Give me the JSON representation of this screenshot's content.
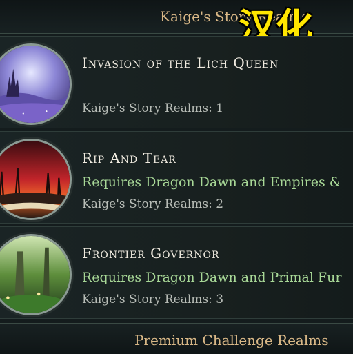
{
  "header": {
    "title": "Kaige's Story Realms"
  },
  "watermark": {
    "text": "汉化"
  },
  "realms": [
    {
      "title": "Invasion of the Lich Queen",
      "requirement": "",
      "subtitle": "Kaige's Story Realms: 1",
      "thumbnail": "lich-queen-castle-thumbnail"
    },
    {
      "title": "Rip And Tear",
      "requirement": "Requires Dragon Dawn and Empires &",
      "subtitle": "Kaige's Story Realms: 2",
      "thumbnail": "burning-battlefield-book-thumbnail"
    },
    {
      "title": "Frontier Governor",
      "requirement": "Requires Dragon Dawn and Primal Fur",
      "subtitle": "Kaige's Story Realms: 3",
      "thumbnail": "forest-glade-thumbnail"
    }
  ],
  "footer": {
    "title": "Premium Challenge Realms"
  },
  "colors": {
    "title_gold": "#d9b887",
    "requirement_green": "#a8d897",
    "watermark_yellow": "#ffe600"
  }
}
